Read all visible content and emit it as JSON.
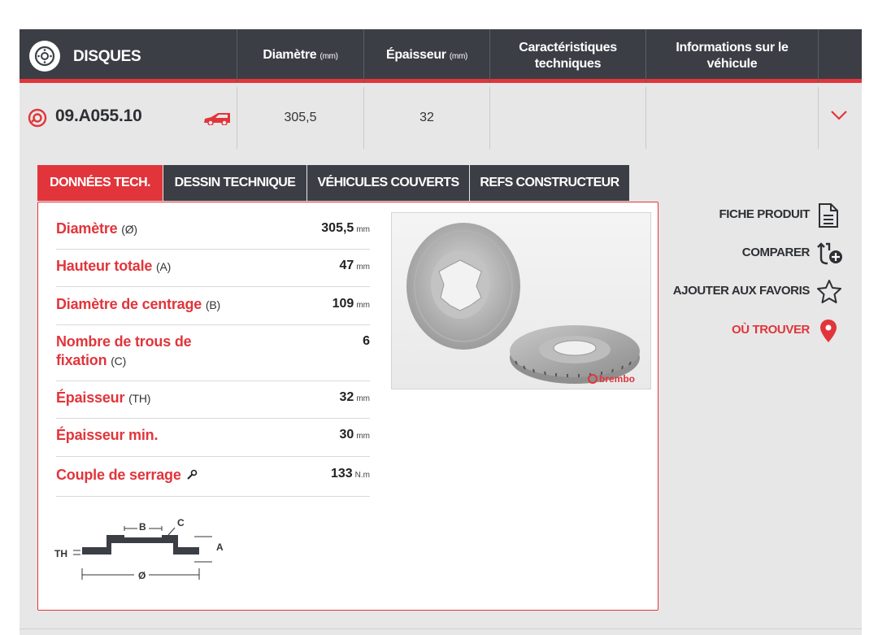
{
  "header": {
    "title": "DISQUES",
    "columns": [
      {
        "label": "Diamètre",
        "unit": "(mm)"
      },
      {
        "label": "Épaisseur",
        "unit": "(mm)"
      },
      {
        "label": "Caractéristiques techniques",
        "unit": ""
      },
      {
        "label": "Informations sur le véhicule",
        "unit": ""
      }
    ]
  },
  "product": {
    "part_number": "09.A055.10",
    "diameter": "305,5",
    "thickness": "32"
  },
  "tabs": [
    {
      "label": "DONNÉES TECH.",
      "active": true
    },
    {
      "label": "DESSIN TECHNIQUE",
      "active": false
    },
    {
      "label": "VÉHICULES COUVERTS",
      "active": false
    },
    {
      "label": "REFS CONSTRUCTEUR",
      "active": false
    }
  ],
  "specs": [
    {
      "label": "Diamètre",
      "sub": "(Ø)",
      "value": "305,5",
      "unit": "mm"
    },
    {
      "label": "Hauteur totale",
      "sub": "(A)",
      "value": "47",
      "unit": "mm"
    },
    {
      "label": "Diamètre de centrage",
      "sub": "(B)",
      "value": "109",
      "unit": "mm"
    },
    {
      "label": "Nombre de trous de",
      "label2": "fixation",
      "sub": "(C)",
      "value": "6",
      "unit": ""
    },
    {
      "label": "Épaisseur",
      "sub": "(TH)",
      "value": "32",
      "unit": "mm"
    },
    {
      "label": "Épaisseur min.",
      "sub": "",
      "value": "30",
      "unit": "mm"
    },
    {
      "label": "Couple de serrage",
      "sub": "",
      "value": "133",
      "unit": "N.m"
    }
  ],
  "diagram": {
    "th": "TH",
    "b": "B",
    "c": "C",
    "a": "A",
    "o": "Ø"
  },
  "photo_brand": "brembo",
  "actions": [
    {
      "label": "FICHE PRODUIT",
      "icon": "document-icon",
      "highlight": false
    },
    {
      "label": "COMPARER",
      "icon": "compare-icon",
      "highlight": false
    },
    {
      "label": "AJOUTER AUX FAVORIS",
      "icon": "star-icon",
      "highlight": false
    },
    {
      "label": "OÙ TROUVER",
      "icon": "location-pin-icon",
      "highlight": true
    }
  ],
  "colors": {
    "accent": "#e1353b",
    "header_bg": "#3b3e45",
    "panel_bg": "#e7e7e7"
  }
}
